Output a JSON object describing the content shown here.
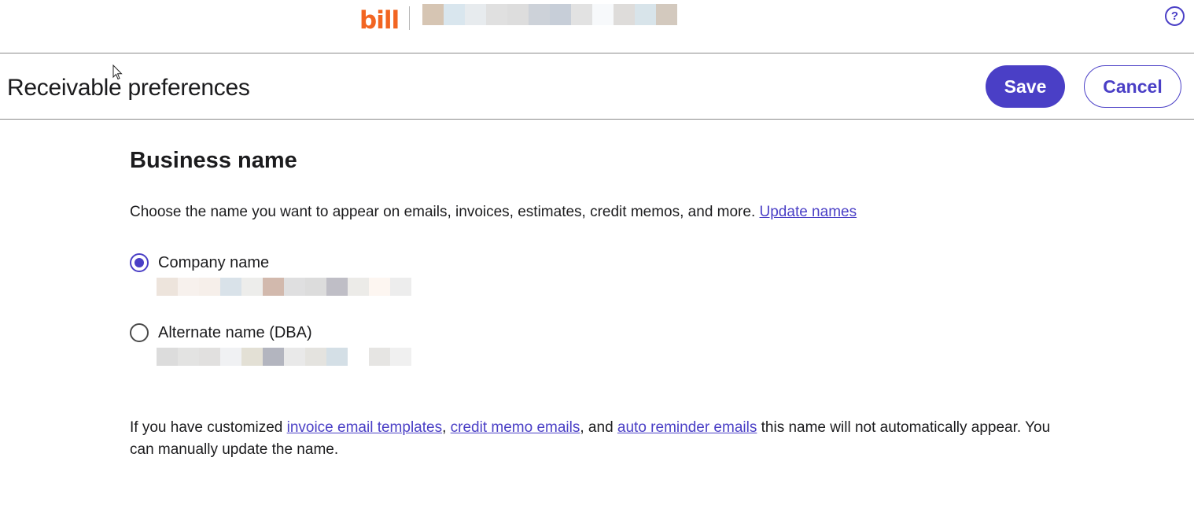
{
  "header": {
    "logo_text": "bill",
    "help_icon": "?",
    "brand_color": "#f26522"
  },
  "page": {
    "title": "Receivable preferences",
    "save_label": "Save",
    "cancel_label": "Cancel",
    "accent_color": "#4a3fc6"
  },
  "business_name": {
    "title": "Business name",
    "description": "Choose the name you want to appear on emails, invoices, estimates, credit memos, and more.",
    "update_link": "Update names",
    "options": [
      {
        "label": "Company name",
        "selected": true
      },
      {
        "label": "Alternate name (DBA)",
        "selected": false
      }
    ]
  },
  "footnote": {
    "prefix": "If you have customized ",
    "link1": "invoice email templates",
    "sep1": ", ",
    "link2": "credit memo emails",
    "sep2": ", and ",
    "link3": "auto reminder emails",
    "suffix": " this name will not automatically appear. You can manually update the name."
  }
}
